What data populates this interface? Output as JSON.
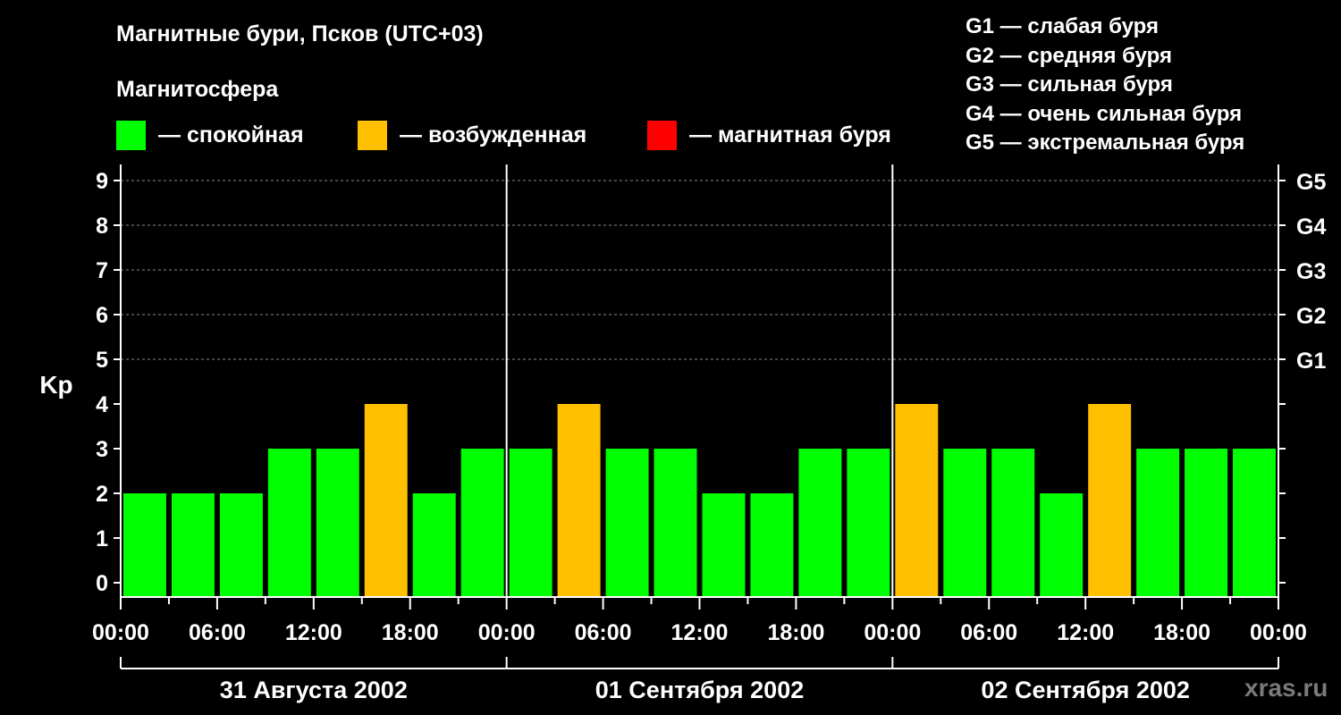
{
  "header": {
    "title": "Магнитные бури, Псков (UTC+03)",
    "subtitle": "Магнитосфера"
  },
  "legend": [
    {
      "label": "— спокойная",
      "color": "#00ff00"
    },
    {
      "label": "— возбужденная",
      "color": "#ffc000"
    },
    {
      "label": "— магнитная буря",
      "color": "#ff0000"
    }
  ],
  "storm_scale": [
    "G1 — слабая буря",
    "G2 — средняя буря",
    "G3 — сильная буря",
    "G4 — очень сильная буря",
    "G5 — экстремальная буря"
  ],
  "watermark": "xras.ru",
  "chart_data": {
    "type": "bar",
    "ylabel": "Kp",
    "ylim": [
      0,
      9
    ],
    "yticks": [
      "0",
      "1",
      "2",
      "3",
      "4",
      "5",
      "6",
      "7",
      "8",
      "9"
    ],
    "right_axis_labels": [
      {
        "kp": 5,
        "label": "G1"
      },
      {
        "kp": 6,
        "label": "G2"
      },
      {
        "kp": 7,
        "label": "G3"
      },
      {
        "kp": 8,
        "label": "G4"
      },
      {
        "kp": 9,
        "label": "G5"
      }
    ],
    "grid": "dashed horizontal at Kp 5–9",
    "xtick_labels": [
      "00:00",
      "06:00",
      "12:00",
      "18:00",
      "00:00",
      "06:00",
      "12:00",
      "18:00",
      "00:00",
      "06:00",
      "12:00",
      "18:00",
      "00:00"
    ],
    "days": [
      "31 Августа 2002",
      "01 Сентября 2002",
      "02 Сентября 2002"
    ],
    "interval_hours": 3,
    "values": [
      2,
      2,
      2,
      3,
      3,
      4,
      2,
      3,
      3,
      4,
      3,
      3,
      2,
      2,
      3,
      3,
      4,
      3,
      3,
      2,
      4,
      3,
      3,
      3
    ],
    "colors": {
      "quiet": "#00ff00",
      "active": "#ffc000",
      "storm": "#ff0000"
    }
  }
}
